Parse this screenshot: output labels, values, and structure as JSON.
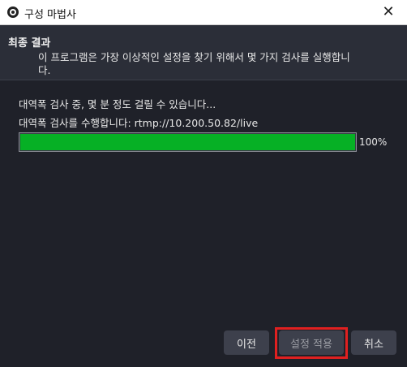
{
  "window": {
    "title": "구성 마법사",
    "close_label": "✕"
  },
  "header": {
    "title": "최종 결과",
    "description": "이 프로그램은 가장 이상적인 설정을 찾기 위해서 몇 가지 검사를 실행합니다."
  },
  "main": {
    "status_line1": "대역폭 검사 중, 몇 분 정도 걸릴 수 있습니다...",
    "status_line2": "대역폭 검사를 수행합니다: rtmp://10.200.50.82/live",
    "progress": {
      "value_percent": 100,
      "label": "100%",
      "fill_color": "#06b025"
    }
  },
  "footer": {
    "back_label": "이전",
    "apply_label": "설정 적용",
    "cancel_label": "취소"
  },
  "colors": {
    "background": "#1f2129",
    "header_bg": "#2b2e38",
    "button_bg": "#3d404c",
    "highlight": "#e02020"
  }
}
